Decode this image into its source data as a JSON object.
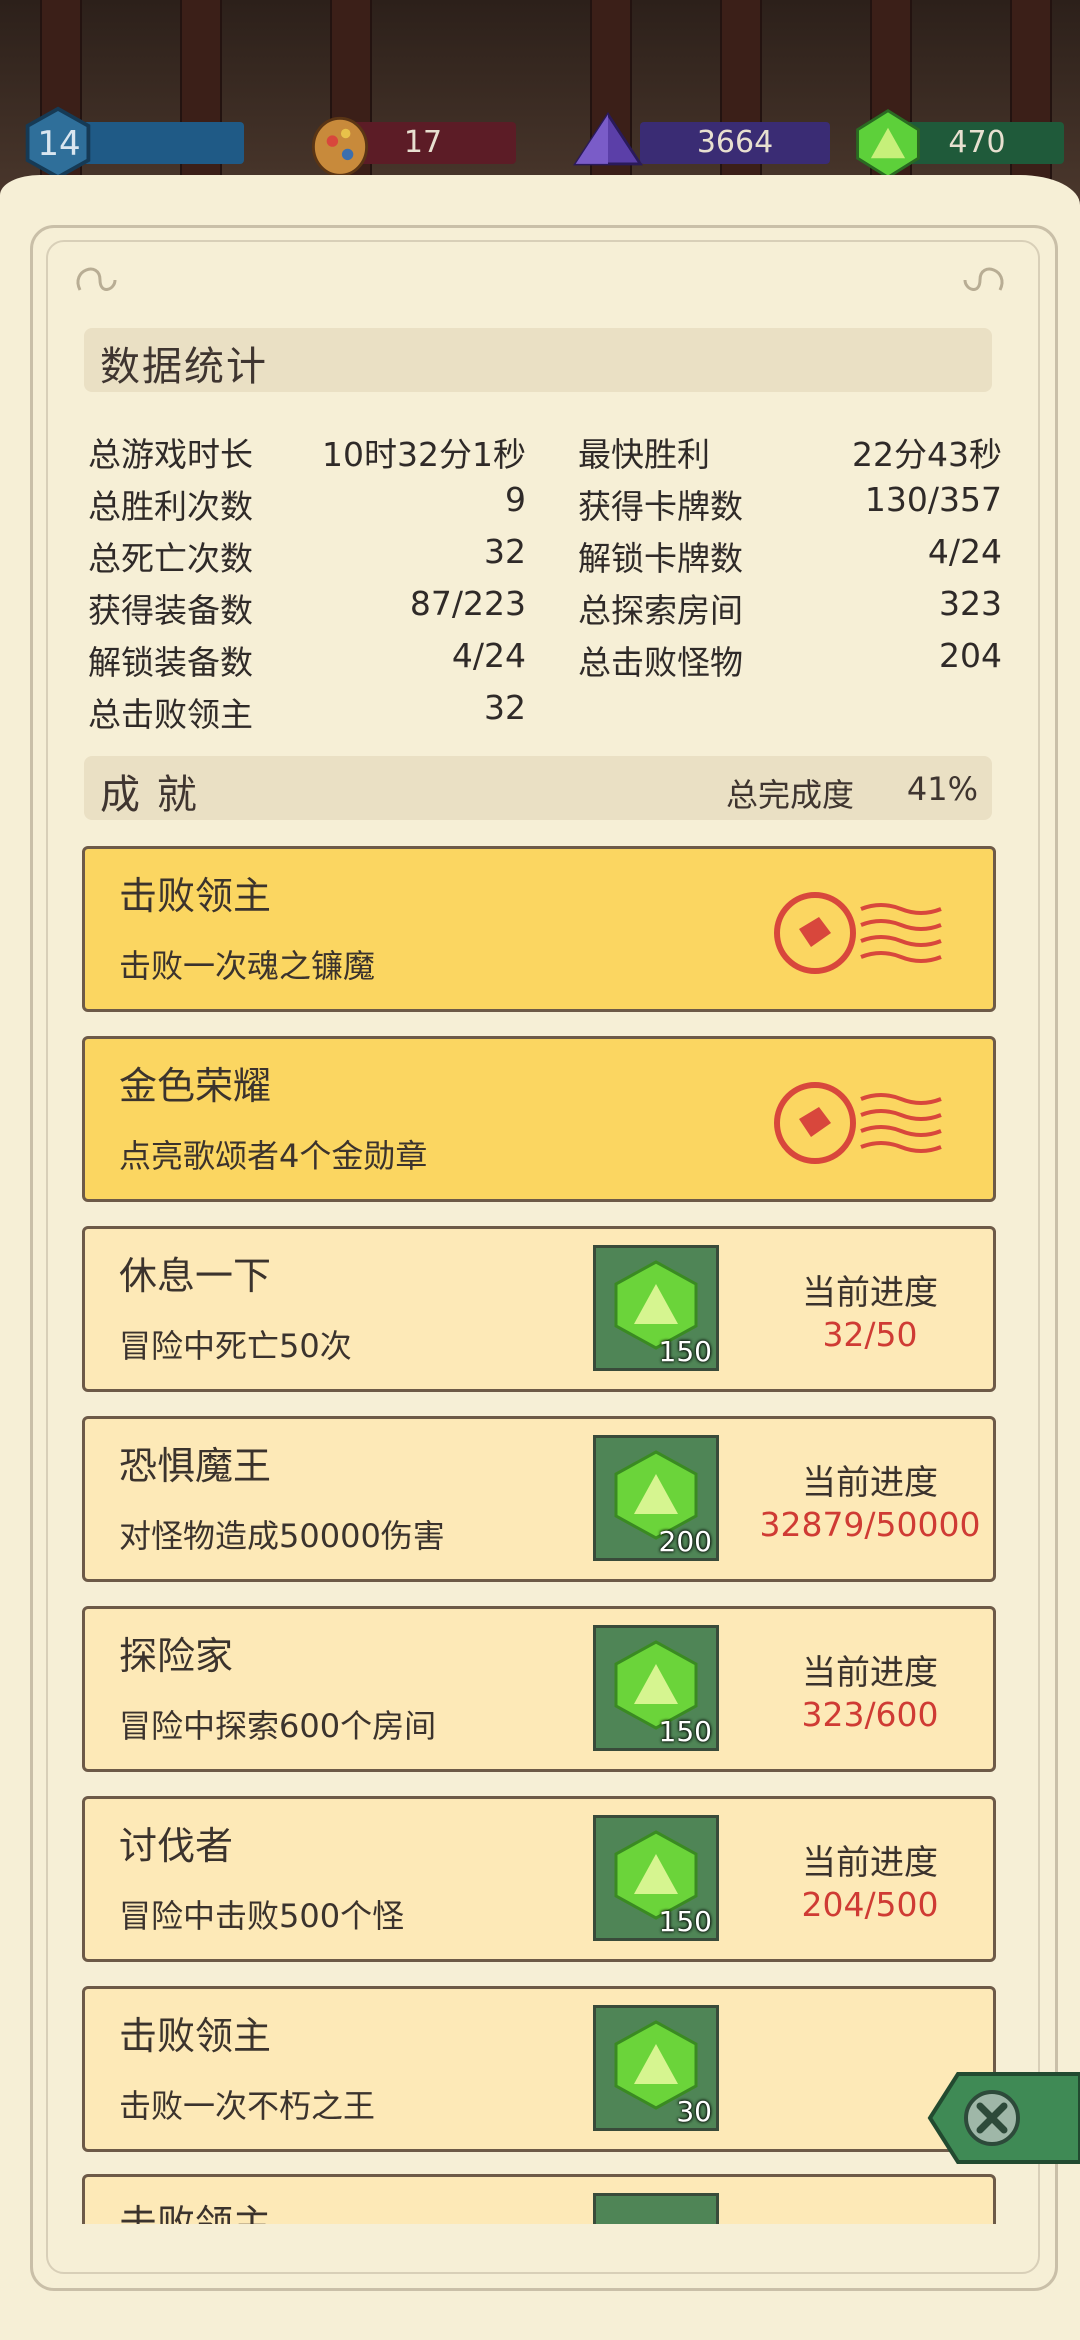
{
  "resources": [
    {
      "name": "level",
      "value": "14",
      "color": "#1f5a86",
      "icon": "shield-hex-icon"
    },
    {
      "name": "orb",
      "value": "17",
      "color": "#5c1c26",
      "icon": "rune-stone-icon"
    },
    {
      "name": "crystal",
      "value": "3664",
      "color": "#3a2c74",
      "icon": "purple-crystal-icon"
    },
    {
      "name": "gem",
      "value": "470",
      "color": "#1f5a3a",
      "icon": "green-gem-icon"
    }
  ],
  "stats": {
    "title": "数据统计",
    "left": [
      {
        "label": "总游戏时长",
        "value": "10时32分1秒"
      },
      {
        "label": "总胜利次数",
        "value": "9"
      },
      {
        "label": "总死亡次数",
        "value": "32"
      },
      {
        "label": "获得装备数",
        "value": "87/223"
      },
      {
        "label": "解锁装备数",
        "value": "4/24"
      },
      {
        "label": "总击败领主",
        "value": "32"
      }
    ],
    "right": [
      {
        "label": "最快胜利",
        "value": "22分43秒"
      },
      {
        "label": "获得卡牌数",
        "value": "130/357"
      },
      {
        "label": "解锁卡牌数",
        "value": "4/24"
      },
      {
        "label": "总探索房间",
        "value": "323"
      },
      {
        "label": "总击败怪物",
        "value": "204"
      }
    ]
  },
  "achievements": {
    "title": "成 就",
    "completion_label": "总完成度",
    "completion_value": "41%",
    "progress_label": "当前进度",
    "items": [
      {
        "title": "击败领主",
        "desc": "击败一次魂之镰魔",
        "completed": true
      },
      {
        "title": "金色荣耀",
        "desc": "点亮歌颂者4个金勋章",
        "completed": true
      },
      {
        "title": "休息一下",
        "desc": "冒险中死亡50次",
        "reward": "150",
        "progress": "32/50",
        "completed": false
      },
      {
        "title": "恐惧魔王",
        "desc": "对怪物造成50000伤害",
        "reward": "200",
        "progress": "32879/50000",
        "completed": false
      },
      {
        "title": "探险家",
        "desc": "冒险中探索600个房间",
        "reward": "150",
        "progress": "323/600",
        "completed": false
      },
      {
        "title": "讨伐者",
        "desc": "冒险中击败500个怪",
        "reward": "150",
        "progress": "204/500",
        "completed": false
      },
      {
        "title": "击败领主",
        "desc": "击败一次不朽之王",
        "reward": "30",
        "progress": "",
        "completed": false
      },
      {
        "title": "击败领主",
        "desc": "",
        "reward": "",
        "progress": "",
        "completed": false
      }
    ]
  },
  "colors": {
    "gold_card": "#fbd661",
    "plain_card": "#fde9b7",
    "progress_red": "#cf3b34",
    "stamp_red": "#d8473c"
  }
}
